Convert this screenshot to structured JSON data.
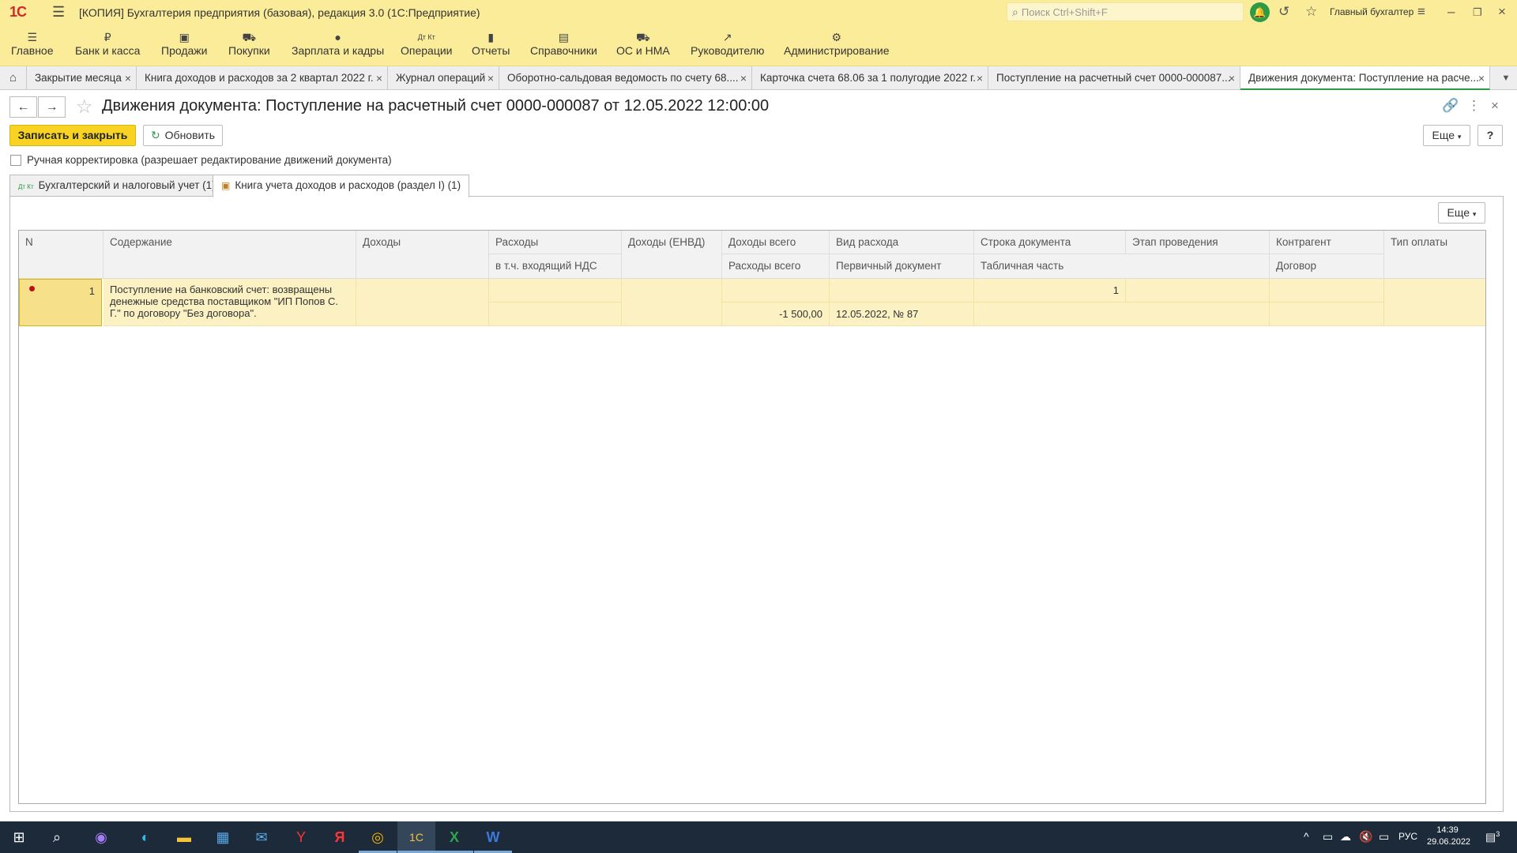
{
  "app": {
    "logo": "1С",
    "title": "[КОПИЯ] Бухгалтерия предприятия (базовая), редакция 3.0  (1С:Предприятие)",
    "search_placeholder": "Поиск Ctrl+Shift+F",
    "user": "Главный бухгалтер"
  },
  "sections": [
    "Главное",
    "Банк и касса",
    "Продажи",
    "Покупки",
    "Зарплата и кадры",
    "Операции",
    "Отчеты",
    "Справочники",
    "ОС и НМА",
    "Руководителю",
    "Администрирование"
  ],
  "open_tabs": [
    "Закрытие месяца",
    "Книга доходов и расходов за 2 квартал 2022 г.",
    "Журнал операций",
    "Оборотно-сальдовая ведомость по счету 68....",
    "Карточка счета 68.06 за 1 полугодие 2022 г.",
    "Поступление на расчетный счет 0000-000087...",
    "Движения документа: Поступление на расче..."
  ],
  "document": {
    "title": "Движения документа: Поступление на расчетный счет 0000-000087 от 12.05.2022 12:00:00",
    "save_close": "Записать и закрыть",
    "refresh": "Обновить",
    "more": "Еще",
    "help": "?",
    "manual_correction": "Ручная корректировка (разрешает редактирование движений документа)",
    "tabs": [
      "Бухгалтерский и налоговый учет (1)",
      "Книга учета доходов и расходов (раздел I) (1)"
    ],
    "tab_icon_0": "Дт Кт"
  },
  "grid": {
    "headers_top": [
      "N",
      "Содержание",
      "Доходы",
      "Расходы",
      "Доходы (ЕНВД)",
      "Доходы всего",
      "Вид расхода",
      "Строка документа",
      "Этап проведения",
      "Контрагент",
      "Тип оплаты"
    ],
    "headers_bottom": {
      "rashody": "в т.ч. входящий НДС",
      "dohody_vsego": "Расходы всего",
      "vid_rashoda": "Первичный документ",
      "stroka": "Табличная часть",
      "kontragent": "Договор"
    },
    "row": {
      "n": "1",
      "content": [
        "Поступление на банковский счет: возвращены",
        "денежные средства поставщиком \"ИП Попов С.",
        "Г.\" по договору \"Без договора\"."
      ],
      "expenses_total": "-1 500,00",
      "primary_doc": "12.05.2022, № 87",
      "doc_line": "1"
    }
  },
  "taskbar": {
    "time": "14:39",
    "date": "29.06.2022",
    "lang": "РУС",
    "notif": "3"
  }
}
